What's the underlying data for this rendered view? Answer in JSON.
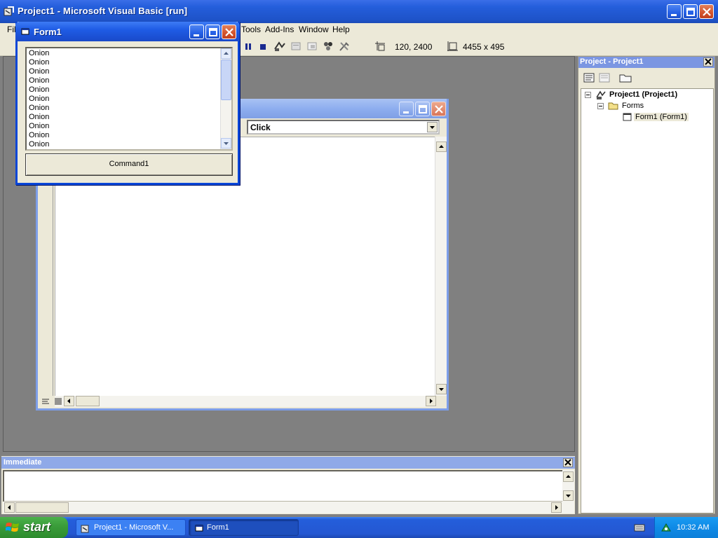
{
  "ide": {
    "title": "Project1 - Microsoft Visual Basic [run]",
    "menu": {
      "file_fragment": "Fil",
      "tools": "Tools",
      "addins": "Add-Ins",
      "window": "Window",
      "help": "Help"
    },
    "toolbar": {
      "position_readout": "120, 2400",
      "size_readout": "4455 x 495"
    }
  },
  "code_window": {
    "procedure_dropdown": "Click"
  },
  "form1": {
    "title": "Form1",
    "list_items": [
      "Onion",
      "Onion",
      "Onion",
      "Onion",
      "Onion",
      "Onion",
      "Onion",
      "Onion",
      "Onion",
      "Onion",
      "Onion"
    ],
    "command_button": "Command1"
  },
  "project_explorer": {
    "title": "Project - Project1",
    "tree": {
      "project": "Project1 (Project1)",
      "forms_folder": "Forms",
      "form_item": "Form1 (Form1)"
    }
  },
  "immediate": {
    "title": "Immediate"
  },
  "taskbar": {
    "start_label": "start",
    "tasks": [
      "Project1 - Microsoft V...",
      "Form1"
    ],
    "clock": "10:32 AM"
  },
  "colors": {
    "xp_title_blue": "#245edb",
    "close_button_red": "#d3532c",
    "start_green": "#3b9e3b",
    "mdi_gray": "#808080"
  }
}
